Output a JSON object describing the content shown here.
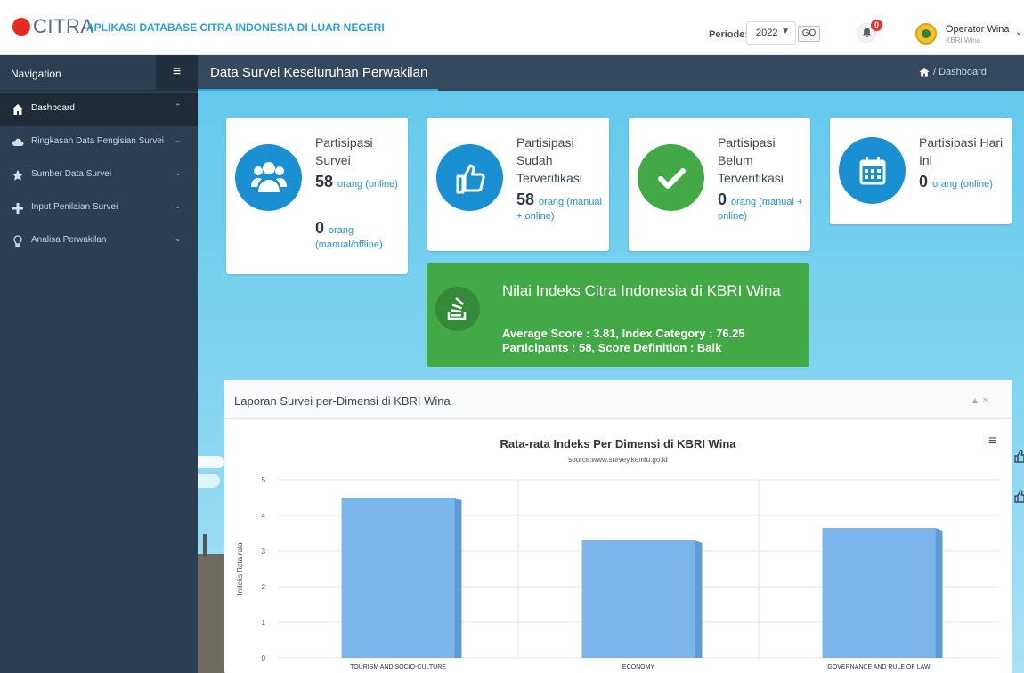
{
  "header": {
    "logo_text": "CITRA",
    "app_title": "APLIKASI DATABASE CITRA INDONESIA DI LUAR NEGERI",
    "periode_label": "Periode:",
    "periode_value": "2022",
    "go_label": "GO",
    "notification_count": "0",
    "user_name": "Operator Wina",
    "user_sub": "KBRI Wina"
  },
  "sidebar": {
    "title": "Navigation",
    "items": [
      {
        "label": "Dashboard",
        "icon": "home-icon",
        "active": true
      },
      {
        "label": "Ringkasan Data Pengisian Survei",
        "icon": "cloud-icon"
      },
      {
        "label": "Sumber Data Survei",
        "icon": "star-icon"
      },
      {
        "label": "Input Penilaian Survei",
        "icon": "plus-icon"
      },
      {
        "label": "Analisa Perwakilan",
        "icon": "bulb-icon"
      }
    ]
  },
  "content_header": {
    "title": "Data Survei Keseluruhan Perwakilan",
    "breadcrumb": "/ Dashboard"
  },
  "stats": [
    {
      "title": "Partisipasi Survei",
      "lines": [
        {
          "num": "58",
          "text": "orang (online)"
        },
        {
          "num": "0",
          "text": "orang (manual/offline)"
        }
      ],
      "color": "#1a8fd1",
      "icon": "users-icon"
    },
    {
      "title": "Partisipasi Sudah Terverifikasi",
      "lines": [
        {
          "num": "58",
          "text": "orang (manual + online)"
        }
      ],
      "color": "#1a8fd1",
      "icon": "thumbs-up-icon"
    },
    {
      "title": "Partisipasi Belum Terverifikasi",
      "lines": [
        {
          "num": "0",
          "text": "orang (manual + online)"
        }
      ],
      "color": "#43a947",
      "icon": "check-icon"
    },
    {
      "title": "Partisipasi Hari Ini",
      "lines": [
        {
          "num": "0",
          "text": "orang (online)"
        }
      ],
      "color": "#1a8fd1",
      "icon": "calendar-icon"
    }
  ],
  "index_card": {
    "title": "Nilai Indeks Citra Indonesia di KBRI Wina",
    "line1": "Average Score : 3.81, Index Category : 76.25",
    "line2": "Participants : 58, Score Definition : Baik"
  },
  "report_panel": {
    "title": "Laporan Survei per-Dimensi di KBRI Wina",
    "tools": "▲ ✕"
  },
  "chart_data": {
    "type": "bar",
    "title": "Rata-rata Indeks Per Dimensi di KBRI Wina",
    "subtitle": "source:www.survey.kemlu.go.id",
    "ylabel": "Indeks Rata-rata",
    "categories": [
      "TOURISM AND SOCIO-CULTURE",
      "ECONOMY",
      "GOVERNANCE AND RULE OF LAW"
    ],
    "values": [
      4.5,
      3.3,
      3.65
    ],
    "ylim": [
      0,
      5
    ],
    "yticks": [
      0,
      1,
      2,
      3,
      4,
      5
    ],
    "bar_color": "#7cb5ec",
    "grid": true
  }
}
